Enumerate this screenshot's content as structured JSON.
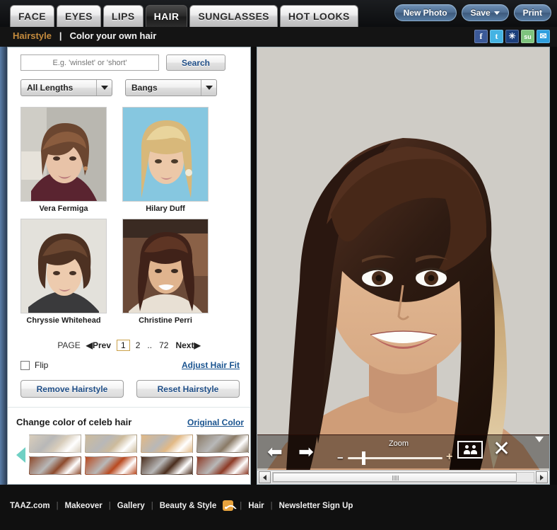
{
  "topbar": {
    "tabs": [
      {
        "label": "FACE",
        "active": false
      },
      {
        "label": "EYES",
        "active": false
      },
      {
        "label": "LIPS",
        "active": false
      },
      {
        "label": "HAIR",
        "active": true
      },
      {
        "label": "SUNGLASSES",
        "active": false
      },
      {
        "label": "HOT LOOKS",
        "active": false
      }
    ],
    "buttons": {
      "new_photo": "New Photo",
      "save": "Save",
      "print": "Print"
    }
  },
  "subheader": {
    "section": "Hairstyle",
    "separator": "|",
    "current": "Color your own hair",
    "socials": [
      {
        "name": "facebook-icon",
        "glyph": "f"
      },
      {
        "name": "twitter-icon",
        "glyph": "t"
      },
      {
        "name": "myspace-icon",
        "glyph": "✳"
      },
      {
        "name": "stumbleupon-icon",
        "glyph": "su"
      },
      {
        "name": "email-icon",
        "glyph": "✉"
      }
    ]
  },
  "left_panel": {
    "search": {
      "placeholder": "E.g. 'winslet' or 'short'",
      "value": "",
      "button": "Search"
    },
    "filters": [
      {
        "name": "length-filter",
        "value": "All Lengths"
      },
      {
        "name": "bangs-filter",
        "value": "Bangs"
      }
    ],
    "thumbnails": [
      {
        "name": "Vera Fermiga"
      },
      {
        "name": "Hilary Duff"
      },
      {
        "name": "Chryssie Whitehead"
      },
      {
        "name": "Christine Perri"
      }
    ],
    "pagination": {
      "label": "PAGE",
      "prev": "◀Prev",
      "pages": [
        "1",
        "2",
        "..",
        "72"
      ],
      "current": "1",
      "next": "Next▶"
    },
    "flip": {
      "label": "Flip",
      "checked": false,
      "adjust_link": "Adjust Hair Fit"
    },
    "actions": {
      "remove": "Remove Hairstyle",
      "reset": "Reset Hairstyle"
    },
    "color_section": {
      "title": "Change color of celeb hair",
      "original_link": "Original Color",
      "swatches": [
        {
          "name": "swatch-platinum-blonde",
          "color": "#d8cdbb"
        },
        {
          "name": "swatch-ash-blonde",
          "color": "#cdbb9c"
        },
        {
          "name": "swatch-golden-blonde",
          "color": "#e2b985"
        },
        {
          "name": "swatch-dark-ash",
          "color": "#8a7a66"
        },
        {
          "name": "swatch-auburn-brown",
          "color": "#8d4a2c"
        },
        {
          "name": "swatch-copper-red",
          "color": "#b9491f"
        },
        {
          "name": "swatch-dark-brown",
          "color": "#4a2d1c"
        },
        {
          "name": "swatch-mahogany",
          "color": "#8d3a26"
        }
      ]
    }
  },
  "right_panel": {
    "toolbar": {
      "prev_arrow": "⬅",
      "next_arrow": "➡",
      "zoom_label": "Zoom",
      "zoom_minus": "−",
      "zoom_plus": "+",
      "faces_icon": "faces-icon",
      "close": "✕"
    }
  },
  "footer": {
    "links": [
      {
        "label": "TAAZ.com"
      },
      {
        "label": "Makeover"
      },
      {
        "label": "Gallery"
      },
      {
        "label": "Beauty & Style"
      },
      {
        "label": "Hair"
      },
      {
        "label": "Newsletter Sign Up"
      }
    ],
    "separator": "|"
  }
}
